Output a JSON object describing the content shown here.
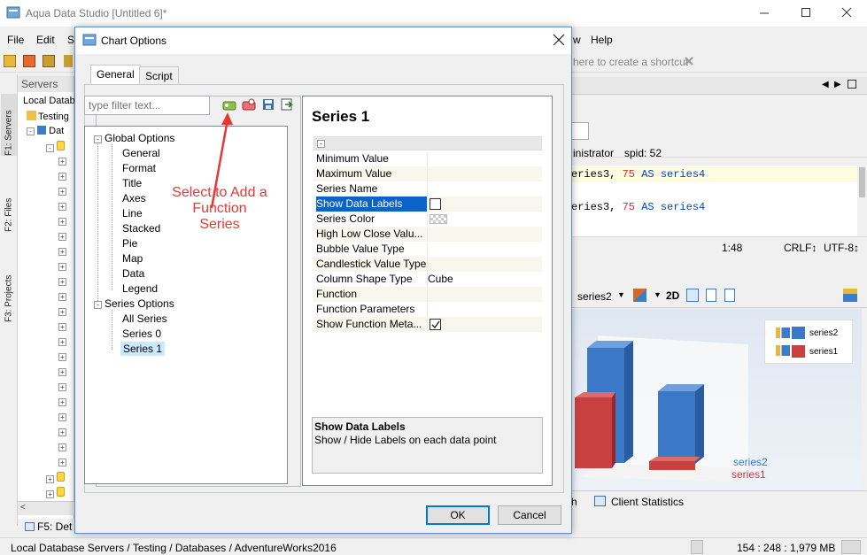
{
  "app": {
    "title": "Aqua Data Studio [Untitled 6]*",
    "menu": {
      "file": "File",
      "edit": "Edit",
      "s_partial": "S",
      "w_partial": "w",
      "help": "Help"
    }
  },
  "sidebar": {
    "servers": "F1: Servers",
    "files": "F2: Files",
    "projects": "F3: Projects"
  },
  "servers_panel": {
    "header": "Servers",
    "items": [
      "Local Datab",
      "Testing",
      "Dat"
    ],
    "bottom_tab": "F5: Det"
  },
  "right_pane": {
    "shortcut_hint": "here to create a shortcut",
    "user": "inistrator",
    "spid": "spid:  52",
    "code_line1_a": "eries3, ",
    "code_line1_num": "75",
    "code_line1_b": " AS series4",
    "code_line2_a": "eries3, ",
    "code_line2_num": "75",
    "code_line2_b": " AS series4",
    "position": "1:48",
    "line_ending": "CRLF↕",
    "encoding": "UTF-8↕",
    "chart_series_select": "series2",
    "toggle_2d": "2D",
    "legend": [
      "series2",
      "series1"
    ],
    "axis_series": [
      "series2",
      "series1"
    ],
    "tab_h": "h",
    "tab_client_stats": "Client Statistics"
  },
  "dialog": {
    "title": "Chart Options",
    "tabs": [
      "General",
      "Script"
    ],
    "filter_placeholder": "type filter text...",
    "tree": {
      "global_options": "Global Options",
      "global_children": [
        "General",
        "Format",
        "Title",
        "Axes",
        "Line",
        "Stacked",
        "Pie",
        "Map",
        "Data",
        "Legend"
      ],
      "series_options": "Series Options",
      "series_children": [
        "All Series",
        "Series 0",
        "Series 1"
      ]
    },
    "annotation": "Select to Add a Function Series",
    "panel_title": "Series 1",
    "properties": [
      {
        "key": "Minimum Value",
        "value": ""
      },
      {
        "key": "Maximum Value",
        "value": ""
      },
      {
        "key": "Series Name",
        "value": ""
      },
      {
        "key": "Show Data Labels",
        "value": ""
      },
      {
        "key": "Series Color",
        "value": ""
      },
      {
        "key": "High Low Close Valu...",
        "value": ""
      },
      {
        "key": "Bubble Value Type",
        "value": ""
      },
      {
        "key": "Candlestick Value Type",
        "value": ""
      },
      {
        "key": "Column Shape Type",
        "value": "Cube"
      },
      {
        "key": "Function",
        "value": ""
      },
      {
        "key": "Function Parameters",
        "value": ""
      },
      {
        "key": "Show Function Meta...",
        "value": ""
      }
    ],
    "show_data_labels_checked": false,
    "show_function_meta_checked": true,
    "description_title": "Show Data Labels",
    "description_text": "Show / Hide Labels on each data point",
    "ok": "OK",
    "cancel": "Cancel"
  },
  "statusbar": {
    "path": "Local Database Servers / Testing / Databases / AdventureWorks2016",
    "memory": "154 : 248 : 1,979 MB"
  },
  "colors": {
    "accent": "#0a64c8",
    "annotation": "#e53935",
    "series2": "#3c78c8",
    "series1": "#c84040"
  }
}
